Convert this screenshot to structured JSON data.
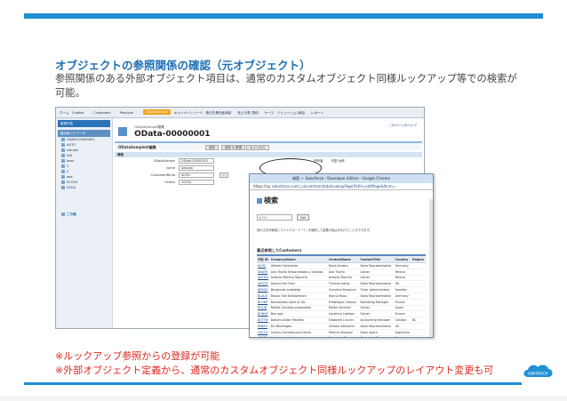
{
  "slide": {
    "title": "オブジェクトの参照関係の確認（元オブジェクト）",
    "body": "参照関係のある外部オブジェクト項目は、通常のカスタムオブジェクト同様ルックアップ等での検索が可能。",
    "notes": [
      "※ルックアップ参照からの登録が可能",
      "※外部オブジェクト定義から、通常のカスタムオブジェクト同様ルックアップのレイアウト変更も可"
    ],
    "logo_text": "salesforce",
    "colors": {
      "accent": "#1f8fd6",
      "title": "#1f6fb4",
      "note": "#e0281e"
    }
  },
  "app": {
    "nav_tabs": [
      "ホーム",
      "Chatter",
      "Customers",
      "Products",
      "ODataSample",
      "キャンペーン",
      "リード",
      "取引先責任者",
      "商談",
      "売上予測",
      "契約",
      "ケース",
      "ソリューション",
      "商品",
      "レポート"
    ],
    "active_tab": "ODataSample",
    "sidebar": {
      "create_label": "新規作成",
      "recent_label": "最近使ったデータ",
      "items": [
        "ODATA-00000001",
        "AUTO",
        "sample",
        "XXL",
        "boss",
        "1",
        "2",
        "aaa",
        "ECCDV",
        "CEGA"
      ],
      "recycle": "ごみ箱"
    },
    "record": {
      "object_label": "ODataSample編集",
      "name": "OData-00000001",
      "help_link": "このページのヘルプ",
      "edit_title": "ODataSampleの編集",
      "buttons": [
        "保存",
        "保存 & 新規",
        "キャンセル"
      ],
      "section": "情報",
      "fields": [
        {
          "label": "ODataSample",
          "value": "OData-00000001"
        },
        {
          "label": "name",
          "value": "aaaaaa"
        },
        {
          "label": "CustomerIDInfo",
          "value": "ALFKI"
        },
        {
          "label": "Orders",
          "value": "10254"
        }
      ],
      "owner_label": "所有者",
      "owner_value": "内部 太郎"
    }
  },
  "popup": {
    "window_title": "検索 ～ Salesforce - Developer Edition - Google Chrome",
    "url_scheme": "https://",
    "url_rest": "ap.salesforce.com/_ui/common/data/LookupPage?lkfm=editPage&lknm=",
    "search_heading": "検索",
    "search_placeholder": "ALFKI",
    "go_label": "Go!",
    "search_note": "他の文字列検索にワイルドカード「*」を使用して結果の絞込みを行うことができます。",
    "results_title": "最近参照したCustomers",
    "columns": [
      "外部 ID",
      "CompanyName",
      "ContactName",
      "ContactTitle",
      "Country",
      "Region"
    ],
    "rows": [
      [
        "ALFKI",
        "Alfreds Futterkiste",
        "Maria Anders",
        "Sales Representative",
        "Germany",
        ""
      ],
      [
        "ANATR",
        "Ana Trujillo Emparedados y helados",
        "Ana Trujillo",
        "Owner",
        "Mexico",
        ""
      ],
      [
        "ANTON",
        "Antonio Moreno Taquería",
        "Antonio Moreno",
        "Owner",
        "Mexico",
        ""
      ],
      [
        "AROUT",
        "Around the Horn",
        "Thomas Hardy",
        "Sales Representative",
        "UK",
        ""
      ],
      [
        "BERGS",
        "Berglunds snabbköp",
        "Christina Berglund",
        "Order Administrator",
        "Sweden",
        ""
      ],
      [
        "BLAUS",
        "Blauer See Delikatessen",
        "Hanna Moos",
        "Sales Representative",
        "Germany",
        ""
      ],
      [
        "BLONP",
        "Blondesddsl père et fils",
        "Frédérique Citeaux",
        "Marketing Manager",
        "France",
        ""
      ],
      [
        "BOLID",
        "Bólido Comidas preparadas",
        "Martín Sommer",
        "Owner",
        "Spain",
        ""
      ],
      [
        "BONAP",
        "Bon app'",
        "Laurence Lebihan",
        "Owner",
        "France",
        ""
      ],
      [
        "BOTTM",
        "Bottom-Dollar Markets",
        "Elizabeth Lincoln",
        "Accounting Manager",
        "Canada",
        "BC"
      ],
      [
        "BSBEV",
        "B's Beverages",
        "Victoria Ashworth",
        "Sales Representative",
        "UK",
        ""
      ],
      [
        "CACTU",
        "Cactus Comidas para llevar",
        "Patricio Simpson",
        "Sales Agent",
        "Argentina",
        ""
      ],
      [
        "CENTC",
        "Centro comercial",
        "Francisco Chang",
        "Marketing Manager",
        "Mexico",
        ""
      ]
    ]
  }
}
